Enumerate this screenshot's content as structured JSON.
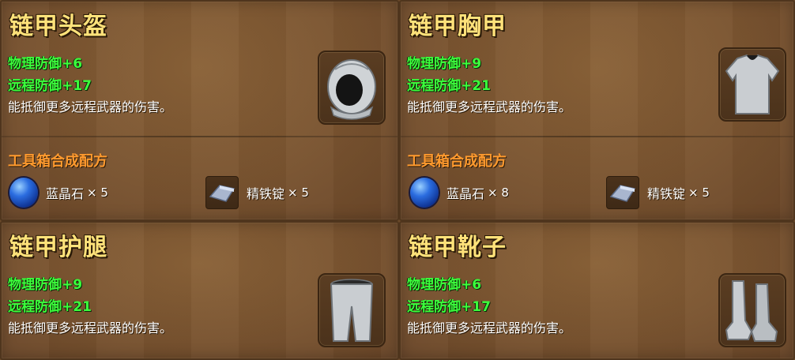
{
  "items": [
    {
      "title": "链甲头盔",
      "stats": [
        "物理防御+6",
        "远程防御+17"
      ],
      "desc": "能抵御更多远程武器的伤害。",
      "icon": "chain-helmet-icon"
    },
    {
      "title": "链甲胸甲",
      "stats": [
        "物理防御+9",
        "远程防御+21"
      ],
      "desc": "能抵御更多远程武器的伤害。",
      "icon": "chain-chestplate-icon"
    },
    {
      "title": "链甲护腿",
      "stats": [
        "物理防御+9",
        "远程防御+21"
      ],
      "desc": "能抵御更多远程武器的伤害。",
      "icon": "chain-leggings-icon"
    },
    {
      "title": "链甲靴子",
      "stats": [
        "物理防御+6",
        "远程防御+17"
      ],
      "desc": "能抵御更多远程武器的伤害。",
      "icon": "chain-boots-icon"
    }
  ],
  "recipes": [
    {
      "title": "工具箱合成配方",
      "materials": [
        {
          "name": "蓝晶石",
          "qty": "× 5",
          "icon": "sapphire-gem-icon"
        },
        {
          "name": "精铁锭",
          "qty": "× 5",
          "icon": "iron-ingot-icon"
        }
      ]
    },
    {
      "title": "工具箱合成配方",
      "materials": [
        {
          "name": "蓝晶石",
          "qty": "× 8",
          "icon": "sapphire-gem-icon"
        },
        {
          "name": "精铁锭",
          "qty": "× 5",
          "icon": "iron-ingot-icon"
        }
      ]
    }
  ],
  "colors": {
    "title": "#ffe27a",
    "stat": "#3cff3c",
    "recipe_title": "#ff9a2e",
    "panel": "#7a5430"
  }
}
